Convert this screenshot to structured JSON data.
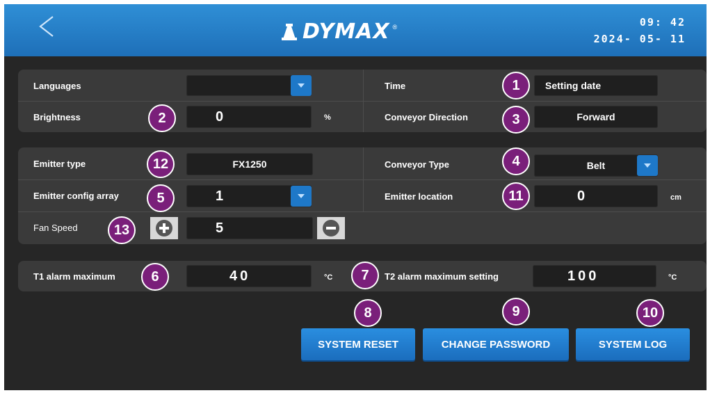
{
  "header": {
    "brand": "DYMAX",
    "registered": "®",
    "time": "09: 42",
    "date": "2024- 05- 11"
  },
  "settings": {
    "languages_label": "Languages",
    "languages_value": "",
    "brightness_label": "Brightness",
    "brightness_value": "0",
    "brightness_unit": "%",
    "time_label": "Time",
    "time_value": "Setting date",
    "conveyor_direction_label": "Conveyor Direction",
    "conveyor_direction_value": "Forward",
    "emitter_type_label": "Emitter type",
    "emitter_type_value": "FX1250",
    "conveyor_type_label": "Conveyor Type",
    "conveyor_type_value": "Belt",
    "emitter_config_label": "Emitter config array",
    "emitter_config_value": "1",
    "emitter_location_label": "Emitter location",
    "emitter_location_value": "0",
    "emitter_location_unit": "cm",
    "fan_speed_label": "Fan Speed",
    "fan_speed_value": "5",
    "t1_label": "T1 alarm maximum",
    "t1_value": "40",
    "t1_unit": "°C",
    "t2_label": "T2 alarm maximum setting",
    "t2_value": "100",
    "t2_unit": "°C"
  },
  "buttons": {
    "system_reset": "SYSTEM RESET",
    "change_password": "CHANGE PASSWORD",
    "system_log": "SYSTEM LOG"
  },
  "callouts": [
    "1",
    "2",
    "3",
    "4",
    "5",
    "6",
    "7",
    "8",
    "9",
    "10",
    "11",
    "12",
    "13"
  ],
  "colors": {
    "header_blue": "#1e78c8",
    "background": "#262626",
    "panel": "#3a3a3a",
    "field": "#1f1f1f",
    "callout": "#7a1f7a"
  },
  "icons": {
    "back": "chevron-left-icon",
    "dropdown": "caret-down-icon",
    "plus": "plus-circle-icon",
    "minus": "minus-circle-icon"
  }
}
